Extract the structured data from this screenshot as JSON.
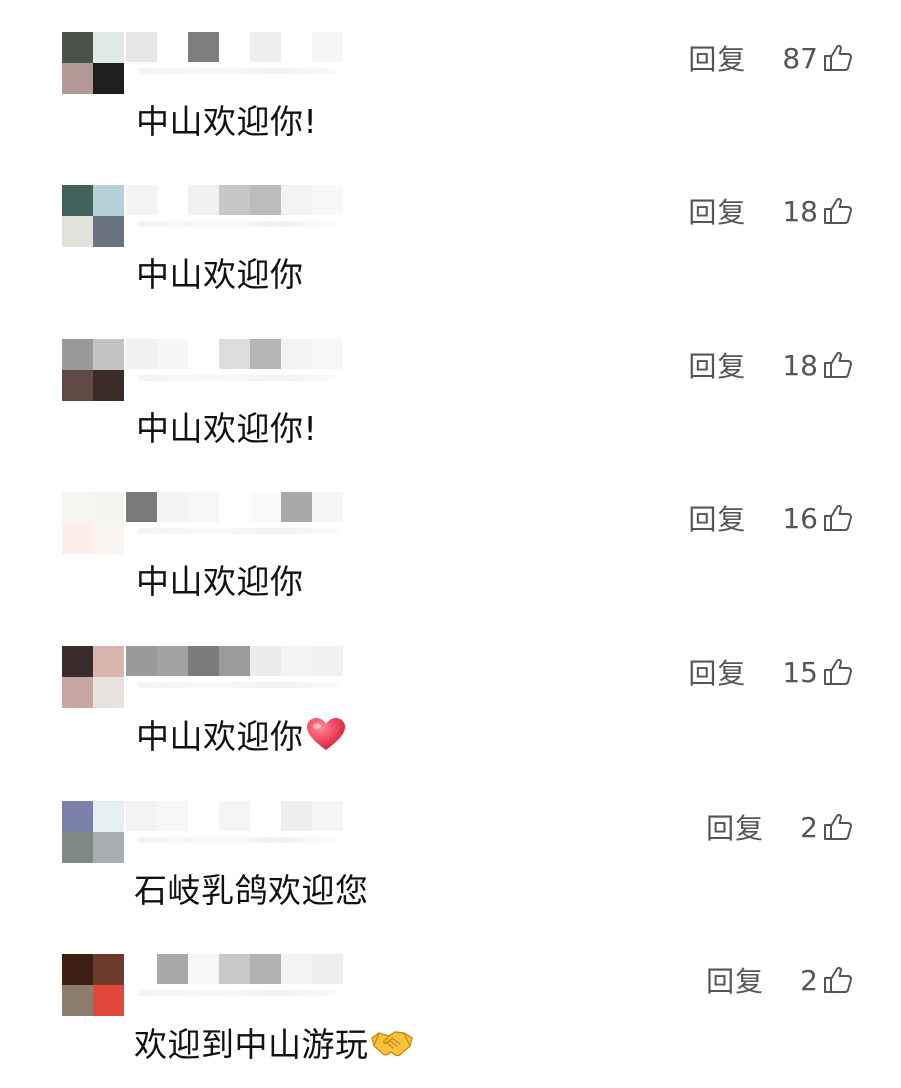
{
  "comments": [
    {
      "text": "中山欢迎你!",
      "reply_label": "回复",
      "likes": "87",
      "emoji": "",
      "avatar_colors": [
        "#4a5249",
        "#dfe9e6",
        "#b39a95",
        "#1f1e1c"
      ],
      "name_blocks": [
        {
          "color": "#e6e6e6"
        },
        {
          "color": "#ffffff"
        },
        {
          "color": "#7d7d7d"
        },
        {
          "color": "#ffffff"
        },
        {
          "color": "#eeeeee"
        },
        {
          "color": "#ffffff"
        },
        {
          "color": "#f6f6f6"
        }
      ]
    },
    {
      "text": "中山欢迎你",
      "reply_label": "回复",
      "likes": "18",
      "emoji": "",
      "avatar_colors": [
        "#42615a",
        "#b4cfd8",
        "#e3e1db",
        "#6a7480"
      ],
      "name_blocks": [
        {
          "color": "#f4f4f4"
        },
        {
          "color": "#ffffff"
        },
        {
          "color": "#f0f0f0"
        },
        {
          "color": "#c7c7c7"
        },
        {
          "color": "#bcbcbc"
        },
        {
          "color": "#f3f3f3"
        },
        {
          "color": "#f8f8f8"
        }
      ]
    },
    {
      "text": "中山欢迎你!",
      "reply_label": "回复",
      "likes": "18",
      "emoji": "",
      "avatar_colors": [
        "#9a9a9a",
        "#c4c4c4",
        "#5f4b43",
        "#3b2a25"
      ],
      "name_blocks": [
        {
          "color": "#f1f1f1"
        },
        {
          "color": "#f6f6f6"
        },
        {
          "color": "#ffffff"
        },
        {
          "color": "#dcdcdc"
        },
        {
          "color": "#b5b5b5"
        },
        {
          "color": "#f2f2f2"
        },
        {
          "color": "#f7f7f7"
        }
      ]
    },
    {
      "text": "中山欢迎你",
      "reply_label": "回复",
      "likes": "16",
      "emoji": "",
      "avatar_colors": [
        "#f6f5f2",
        "#f4f4f1",
        "#fbeee6",
        "#f7f4f2"
      ],
      "name_blocks": [
        {
          "color": "#7a7a7a"
        },
        {
          "color": "#f4f4f4"
        },
        {
          "color": "#f7f7f7"
        },
        {
          "color": "#ffffff"
        },
        {
          "color": "#fafafa"
        },
        {
          "color": "#a9a9a9"
        },
        {
          "color": "#f6f6f6"
        }
      ]
    },
    {
      "text": "中山欢迎你",
      "reply_label": "回复",
      "likes": "15",
      "emoji": "heart",
      "avatar_colors": [
        "#3a2c2c",
        "#d8b6ad",
        "#c7a7a1",
        "#e8e3e0"
      ],
      "name_blocks": [
        {
          "color": "#9a9a9a"
        },
        {
          "color": "#a3a3a3"
        },
        {
          "color": "#7c7c7c"
        },
        {
          "color": "#9b9b9b"
        },
        {
          "color": "#ececec"
        },
        {
          "color": "#f4f4f4"
        },
        {
          "color": "#f1f1f1"
        }
      ]
    },
    {
      "text": "石岐乳鸽欢迎您",
      "reply_label": "回复",
      "likes": "2",
      "emoji": "",
      "avatar_colors": [
        "#7a81a8",
        "#e4f0f2",
        "#7f8a86",
        "#a9afb0"
      ],
      "name_blocks": [
        {
          "color": "#f3f3f3"
        },
        {
          "color": "#f7f7f7"
        },
        {
          "color": "#ffffff"
        },
        {
          "color": "#f5f5f5"
        },
        {
          "color": "#ffffff"
        },
        {
          "color": "#eeeeee"
        },
        {
          "color": "#f6f6f6"
        }
      ]
    },
    {
      "text": "欢迎到中山游玩",
      "reply_label": "回复",
      "likes": "2",
      "emoji": "handshake",
      "avatar_colors": [
        "#3d1f14",
        "#6a3a2c",
        "#8c7e6f",
        "#e3473b"
      ],
      "name_blocks": [
        {
          "color": "#ffffff"
        },
        {
          "color": "#a8a8a8"
        },
        {
          "color": "#f7f7f7"
        },
        {
          "color": "#c9c9c9"
        },
        {
          "color": "#b2b2b2"
        },
        {
          "color": "#f3f3f3"
        },
        {
          "color": "#efefef"
        }
      ]
    }
  ],
  "icons": {
    "like": "thumbs-up-icon",
    "heart": "red-heart-emoji",
    "handshake": "handshake-emoji"
  }
}
